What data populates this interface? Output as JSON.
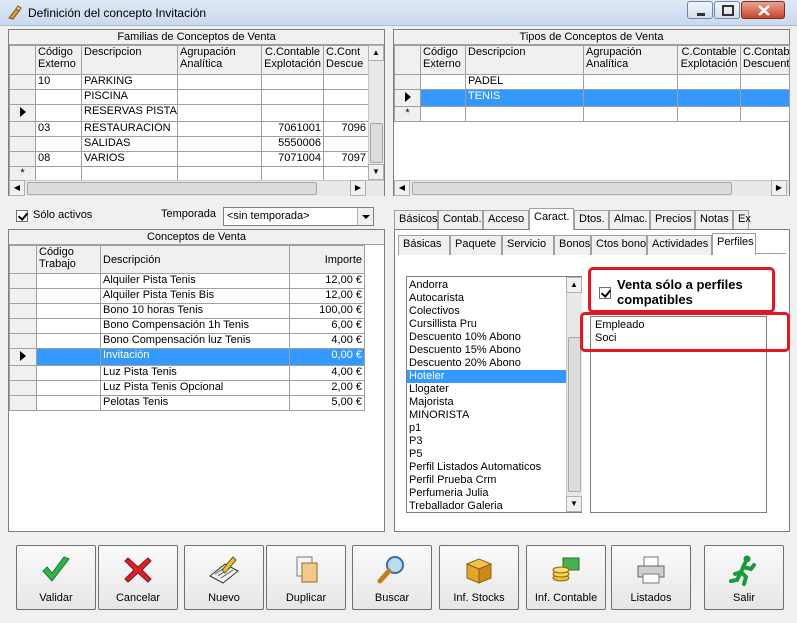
{
  "window": {
    "title": "Definición del concepto Invitación"
  },
  "familias": {
    "title": "Familias de Conceptos de Venta",
    "columns": [
      "Código Externo",
      "Descripcion",
      "Agrupación Analítica",
      "C.Contable Explotación",
      "C.Cont Descue"
    ],
    "rows": [
      [
        "10",
        "PARKING",
        "",
        "",
        ""
      ],
      [
        "",
        "PISCINA",
        "",
        "",
        ""
      ],
      [
        "",
        "RESERVAS PISTAS",
        "",
        "",
        ""
      ],
      [
        "03",
        "RESTAURACIÓN",
        "",
        "7061001",
        "7096"
      ],
      [
        "",
        "SALIDAS",
        "",
        "5550006",
        ""
      ],
      [
        "08",
        "VARIOS",
        "",
        "7071004",
        "7097"
      ]
    ],
    "current_row": 2
  },
  "tipos": {
    "title": "Tipos de Conceptos de Venta",
    "columns": [
      "Código Externo",
      "Descripcion",
      "Agrupación Analítica",
      "C.Contable Explotación",
      "C.Contab Descuent"
    ],
    "rows": [
      [
        "",
        "PADEL",
        "",
        "",
        ""
      ],
      [
        "",
        "TENIS",
        "",
        "",
        ""
      ]
    ],
    "selected_row": 1
  },
  "filters": {
    "solo_activos_label": "Sólo activos",
    "temporada_label": "Temporada",
    "temporada_value": "<sin temporada>"
  },
  "conceptos": {
    "title": "Conceptos de Venta",
    "columns": [
      "Código Trabajo",
      "Descripción",
      "Importe"
    ],
    "rows": [
      [
        "",
        "Alquiler Pista Tenis",
        "12,00 €"
      ],
      [
        "",
        "Alquiler Pista Tenis Bis",
        "12,00 €"
      ],
      [
        "",
        "Bono 10 horas Tenis",
        "100,00 €"
      ],
      [
        "",
        "Bono Compensación 1h Tenis",
        "6,00 €"
      ],
      [
        "",
        "Bono Compensación luz Tenis",
        "4,00 €"
      ],
      [
        "",
        "Invitación",
        "0,00 €"
      ],
      [
        "",
        "Luz Pista Tenis",
        "4,00 €"
      ],
      [
        "",
        "Luz Pista Tenis Opcional",
        "2,00 €"
      ],
      [
        "",
        "Pelotas Tenis",
        "5,00 €"
      ]
    ],
    "selected_row": 5
  },
  "tabs_row1": [
    "Básicos",
    "Contab.",
    "Acceso",
    "Caract.",
    "Dtos.",
    "Almac.",
    "Precios",
    "Notas",
    "Ex"
  ],
  "tabs_row1_active": 3,
  "tabs_row2": [
    "Básicas",
    "Paquete",
    "Servicio",
    "Bonos",
    "Ctos bono",
    "Actividades",
    "Perfiles"
  ],
  "tabs_row2_active": 6,
  "perfiles": {
    "available": [
      "Andorra",
      "Autocarista",
      "Colectivos",
      "Cursillista Pru",
      "Descuento 10% Abono",
      "Descuento 15% Abono",
      "Descuento 20% Abono",
      "Hoteler",
      "Llogater",
      "Majorista",
      "MINORISTA",
      "p1",
      "P3",
      "P5",
      "Perfil Listados Automaticos",
      "Perfil Prueba Crm",
      "Perfumeria Julia",
      "Treballador Galeria"
    ],
    "available_selected": 7,
    "venta_label": "Venta sólo a perfiles compatibles",
    "selected": [
      "Empleado",
      "Soci"
    ]
  },
  "buttons": [
    {
      "label": "Validar",
      "icon": "check-icon"
    },
    {
      "label": "Cancelar",
      "icon": "x-icon"
    },
    {
      "label": "Nuevo",
      "icon": "new-doc-icon"
    },
    {
      "label": "Duplicar",
      "icon": "copy-icon"
    },
    {
      "label": "Buscar",
      "icon": "magnifier-icon"
    },
    {
      "label": "Inf. Stocks",
      "icon": "box-icon"
    },
    {
      "label": "Inf. Contable",
      "icon": "coins-icon"
    },
    {
      "label": "Listados",
      "icon": "printer-icon"
    },
    {
      "label": "Salir",
      "icon": "running-man-icon"
    }
  ],
  "colors": {
    "selection": "#3399ff",
    "highlight": "#e4161f",
    "face": "#f0f0f0"
  }
}
